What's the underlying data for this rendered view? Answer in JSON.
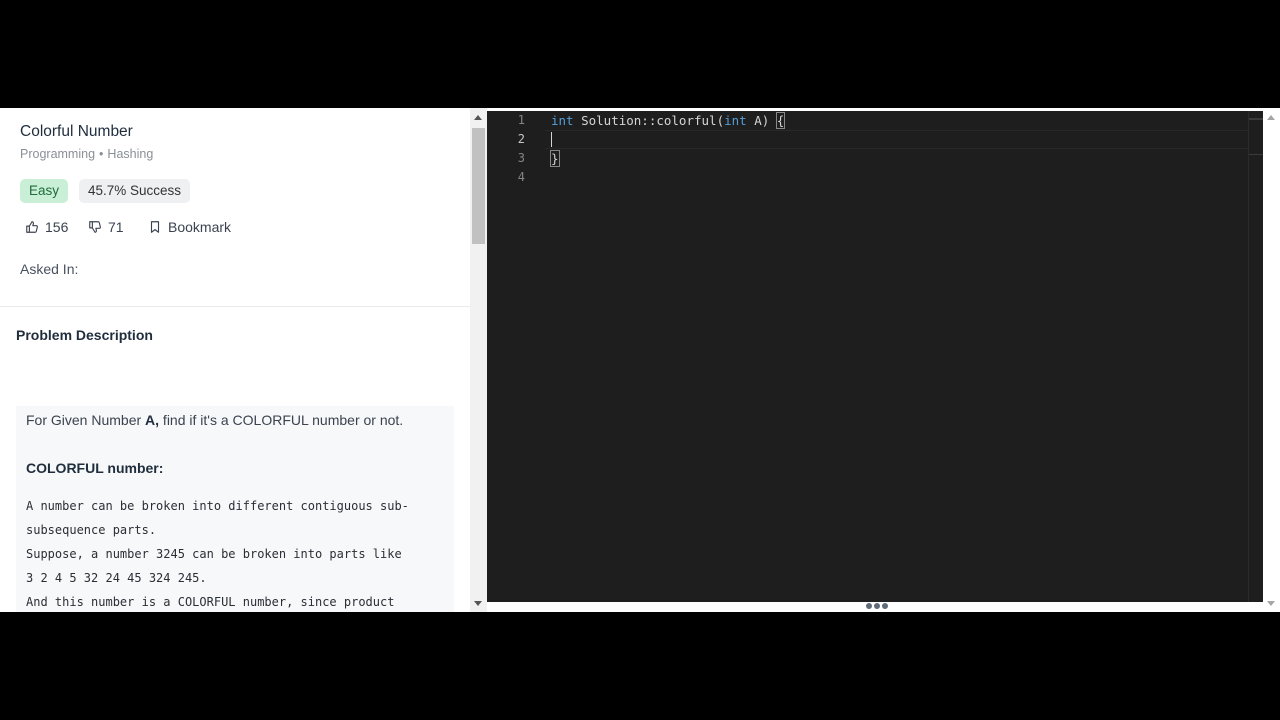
{
  "problem": {
    "title": "Colorful Number",
    "category": "Programming",
    "topic": "Hashing",
    "difficulty": "Easy",
    "success_rate": "45.7% Success",
    "upvotes": "156",
    "downvotes": "71",
    "bookmark_label": "Bookmark",
    "asked_in_label": "Asked In:"
  },
  "description": {
    "heading": "Problem Description",
    "intro_prefix": "For Given Number ",
    "intro_bold": "A,",
    "intro_suffix": " find if it's a COLORFUL number or not.",
    "subheading": "COLORFUL number:",
    "code_lines": [
      "A number can be broken into different contiguous sub-",
      "subsequence parts.",
      "Suppose, a number 3245 can be broken into parts like",
      "3 2 4 5 32 24 45 324 245.",
      "And this number is a COLORFUL number, since product"
    ]
  },
  "editor": {
    "line_numbers": [
      "1",
      "2",
      "3",
      "4"
    ],
    "line1_kw": "int",
    "line1_mid": " Solution::colorful(",
    "line1_kw2": "int",
    "line1_end": " A) ",
    "line1_brace": "{",
    "line3": "}",
    "active_line": 2
  },
  "colors": {
    "easy_bg": "#c9f0d6",
    "easy_text": "#1f6b3c",
    "editor_bg": "#1e1e1e",
    "keyword": "#569cd6"
  },
  "icons": [
    "thumbs-up-icon",
    "thumbs-down-icon",
    "bookmark-icon",
    "drag-handle-icon"
  ]
}
